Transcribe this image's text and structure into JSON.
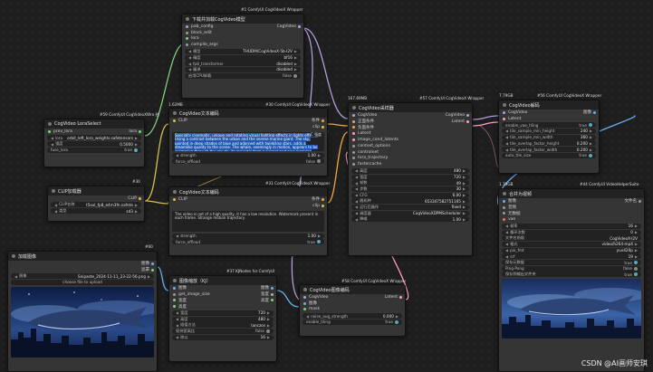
{
  "watermark": "CSDN @AI画师安琪",
  "tags": {
    "download": "#1 ComfyUI CogVideoX Wrapper",
    "lora": "#59 ComfyUI CogVideoXWra 经",
    "clip": "#30",
    "text_pos": "#30 ComfyUI CogVideoX Wrapper",
    "text_pos_id": "1.62MB",
    "text_neg": "#31 ComfyUI CogVideoX Wrapper",
    "sampler": "#57 ComfyUI CogVideoX Wrapper",
    "sampler_id": "167.69MB",
    "decode": "#56 ComfyUI CogVideoX Wrapper",
    "decode_id": "7.79GB",
    "load_image": "#60",
    "resize": "#37 KJNodes for ComfyUI",
    "encode": "#58 ComfyUI CogVideoX Wrapper",
    "combine": "#44 ComfyUI VideoHelperSuite",
    "combine_id": "1.79GB"
  },
  "nodes": {
    "download": {
      "title": "下载并加载CogVideo模型",
      "inputs": [
        "pab_config",
        "block_edit",
        "lora",
        "compile_args"
      ],
      "widgets": [
        {
          "label": "模型",
          "value": "THUDM/CogVideoX-5b-I2V"
        },
        {
          "label": "精度",
          "value": "bf16"
        },
        {
          "label": "fp8_transformer",
          "value": "disabled"
        },
        {
          "label": "编译",
          "value": "disabled"
        }
      ],
      "toggle": {
        "label": "启用CPU卸载",
        "value": "false"
      }
    },
    "lora": {
      "title": "CogVideo LoraSelect",
      "inputs": [
        "prev_lora"
      ],
      "output": "lora",
      "widgets": [
        {
          "label": "lora",
          "value": "orbit_left_lora_weights.safetensors"
        },
        {
          "label": "强度",
          "value": "0.5000"
        }
      ],
      "toggle": {
        "label": "fuse_lora",
        "value": "true"
      }
    },
    "clip": {
      "title": "CLIP加载器",
      "output": "CLIP",
      "widgets": [
        {
          "label": "CLIP名称",
          "value": "t5xxl_fp8_e4m3fn.safete"
        },
        {
          "label": "类型",
          "value": "sd3"
        }
      ]
    },
    "text_pos": {
      "title": "CogVideo文本编码",
      "input": "CLIP",
      "outputs": [
        "条件",
        "clip"
      ],
      "extra_label": "C 强度",
      "text": "Specially cinematic, unique and rotating visual lighting effects in lights effects. Using a contrast between the urban and the serene marine giant. The sky, painted in deep shades of blue and adorned with twinkling stars, adds a dreamlike quality to the scene. The whale, seemingly in motion, appears to be swimming through the clouds, its majestic form a surreal and awe-inspiring sight against the backdrop",
      "widgets": [
        {
          "label": "strength",
          "value": "1.00"
        }
      ],
      "toggle": {
        "label": "force_offload",
        "value": "false"
      }
    },
    "text_neg": {
      "title": "CogVideo文本编码",
      "input": "CLIP",
      "outputs": [
        "条件",
        "clip"
      ],
      "text": "The video is not of a high quality, it has a low resolution. Watermark present in each frame. Strange motion trajectory.",
      "widgets": [
        {
          "label": "strength",
          "value": "1.00"
        }
      ],
      "toggle": {
        "label": "force_offload",
        "value": "true"
      }
    },
    "sampler": {
      "title": "CogVideo采样器",
      "inputs": [
        "CogVideo",
        "正面条件",
        "负面条件",
        "Latent",
        "image_cond_latents",
        "context_options",
        "controlnet",
        "tora_trajectory",
        "fastercache"
      ],
      "outputs": [
        "CogVideo",
        "Latent"
      ],
      "widgets": [
        {
          "label": "高度",
          "value": "480"
        },
        {
          "label": "宽度",
          "value": "720"
        },
        {
          "label": "帧数",
          "value": "49"
        },
        {
          "label": "步数",
          "value": "30"
        },
        {
          "label": "CFG",
          "value": "6.00"
        },
        {
          "label": "随机种",
          "value": "653347582751165"
        },
        {
          "label": "运行后操作",
          "value": "fixed"
        },
        {
          "label": "调度器",
          "value": "CogVideoXDPMScheduler"
        },
        {
          "label": "降噪",
          "value": "1.00"
        }
      ]
    },
    "decode": {
      "title": "CogVideo解码",
      "inputs": [
        "CogVideo",
        "Latent"
      ],
      "output": "图像",
      "toggle": {
        "label": "enable_vae_tiling",
        "value": "true"
      },
      "widgets": [
        {
          "label": "tile_sample_min_height",
          "value": "240"
        },
        {
          "label": "tile_sample_min_width",
          "value": "360"
        },
        {
          "label": "tile_overlap_factor_height",
          "value": "0.200"
        },
        {
          "label": "tile_overlap_factor_width",
          "value": "0.200"
        }
      ],
      "toggle2": {
        "label": "auto_tile_size",
        "value": "true"
      }
    },
    "load_image": {
      "title": "加载图像",
      "outputs": [
        "图像",
        "遮罩"
      ],
      "widgets": [
        {
          "label": "图像",
          "value": "Snipaste_2024-11-11_23-22-56.png"
        }
      ],
      "button": "choose file to upload"
    },
    "resize": {
      "title": "图像缩放（KJ）",
      "inputs": [
        "图像",
        "get_image_size",
        "宽度",
        "高度"
      ],
      "outputs": [
        "图像",
        "宽度",
        "高度"
      ],
      "widgets": [
        {
          "label": "宽度",
          "value": "720"
        },
        {
          "label": "高度",
          "value": "480"
        },
        {
          "label": "插值方法",
          "value": "lanczos"
        }
      ],
      "toggle": {
        "label": "保持宽高比",
        "value": "false"
      },
      "widgets2": [
        {
          "label": "除以",
          "value": "16"
        }
      ]
    },
    "encode": {
      "title": "CogVideo图像编码",
      "inputs": [
        "CogVideo",
        "图像",
        "mask"
      ],
      "output": "Latent",
      "widgets": [
        {
          "label": "noise_aug_strength",
          "value": "0.000"
        }
      ],
      "toggle": {
        "label": "enable_tiling",
        "value": "true"
      }
    },
    "combine": {
      "title": "合并为视频",
      "inputs": [
        "图像",
        "音频",
        "元数据",
        "vae"
      ],
      "output": "文件名",
      "widgets": [
        {
          "label": "帧率",
          "value": "16"
        },
        {
          "label": "循环次数",
          "value": "0"
        },
        {
          "label": "文件名前缀",
          "value": "CogVideoX-I2V"
        },
        {
          "label": "格式",
          "value": "video/h264-mp4"
        },
        {
          "label": "pix_fmt",
          "value": "yuv420p"
        },
        {
          "label": "crf",
          "value": "19"
        }
      ],
      "toggles": [
        {
          "label": "保存元数据",
          "value": "true"
        },
        {
          "label": "Ping-Pong",
          "value": "false"
        },
        {
          "label": "保存到输出文件夹",
          "value": "true"
        }
      ]
    }
  }
}
